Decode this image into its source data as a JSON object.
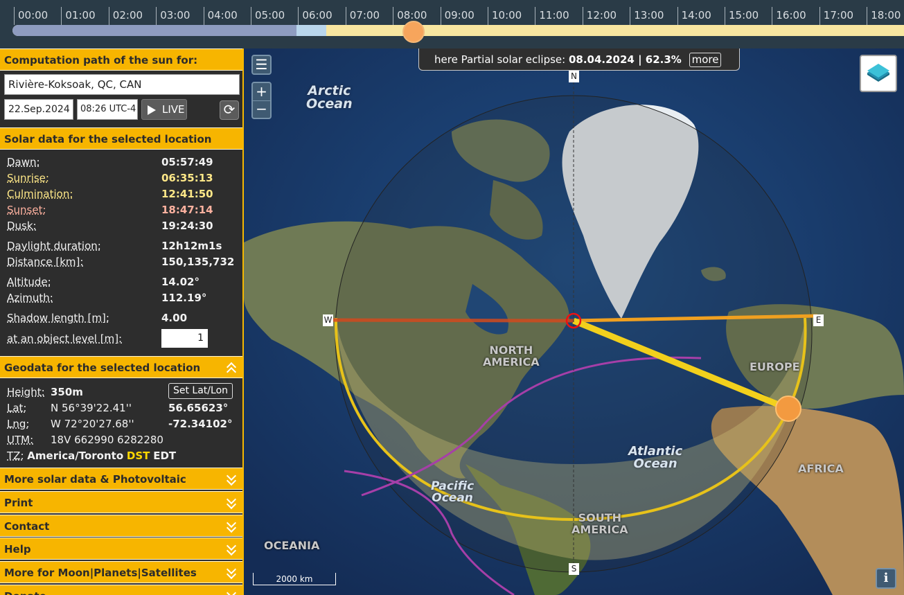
{
  "timeline": {
    "hours": [
      "00:00",
      "01:00",
      "02:00",
      "03:00",
      "04:00",
      "05:00",
      "06:00",
      "07:00",
      "08:00",
      "09:00",
      "10:00",
      "11:00",
      "12:00",
      "13:00",
      "14:00",
      "15:00",
      "16:00",
      "17:00",
      "18:00"
    ]
  },
  "panel": {
    "header_title": "Computation path of the sun for:",
    "location": "Rivière-Koksoak, QC, CAN",
    "date": "22.Sep.2024",
    "time": "08:26 UTC-4",
    "live_label": "LIVE",
    "refresh_icon": "refresh-icon",
    "solar_header": "Solar data for the selected location",
    "solar": {
      "dawn_label": "Dawn:",
      "dawn": "05:57:49",
      "sunrise_label": "Sunrise:",
      "sunrise": "06:35:13",
      "culmination_label": "Culmination:",
      "culmination": "12:41:50",
      "sunset_label": "Sunset:",
      "sunset": "18:47:14",
      "dusk_label": "Dusk:",
      "dusk": "19:24:30",
      "daylight_label": "Daylight duration:",
      "daylight": "12h12m1s",
      "distance_label": "Distance [km]:",
      "distance": "150,135,732",
      "altitude_label": "Altitude:",
      "altitude": "14.02°",
      "azimuth_label": "Azimuth:",
      "azimuth": "112.19°",
      "shadow_label": "Shadow length [m]:",
      "shadow": "4.00",
      "object_level_label": "at an object level [m]:",
      "object_level": "1"
    },
    "geo_header": "Geodata for the selected location",
    "geo": {
      "height_label": "Height:",
      "height": "350m",
      "set_latlon": "Set Lat/Lon",
      "lat_label": "Lat:",
      "lat_dms": "N 56°39'22.41''",
      "lat_dec": "56.65623°",
      "lng_label": "Lng:",
      "lng_dms": "W 72°20'27.68''",
      "lng_dec": "-72.34102°",
      "utm_label": "UTM:",
      "utm": "18V 662990 6282280",
      "tz_label": "TZ:",
      "tz": "America/Toronto",
      "dst": "DST",
      "tz_abbr": "EDT"
    },
    "sections": [
      "More solar data & Photovoltaic",
      "Print",
      "Contact",
      "Help",
      "More for Moon|Planets|Satellites",
      "Donate"
    ]
  },
  "map": {
    "eclipse_prefix": "here Partial solar eclipse: ",
    "eclipse_info": "08.04.2024 | 62.3%",
    "eclipse_more": "more",
    "menu_icon": "☰",
    "zoom_in": "+",
    "zoom_out": "−",
    "info_label": "i",
    "compass": {
      "n": "N",
      "s": "S",
      "e": "E",
      "w": "W"
    },
    "scale": "2000 km",
    "labels": {
      "arctic_ocean": "Arctic\nOcean",
      "north_america": "NORTH\nAMERICA",
      "europe": "EUROPE",
      "atlantic_ocean": "Atlantic\nOcean",
      "africa": "AFRICA",
      "pacific_ocean": "Pacific\nOcean",
      "south_america": "SOUTH\nAMERICA",
      "oceania": "OCEANIA"
    }
  },
  "colors": {
    "accent": "#f7b500",
    "panel_bg": "#2d2d2d",
    "sunrise": "#ffe888",
    "sunset": "#ffb2a0",
    "sun": "#f7a55c"
  }
}
